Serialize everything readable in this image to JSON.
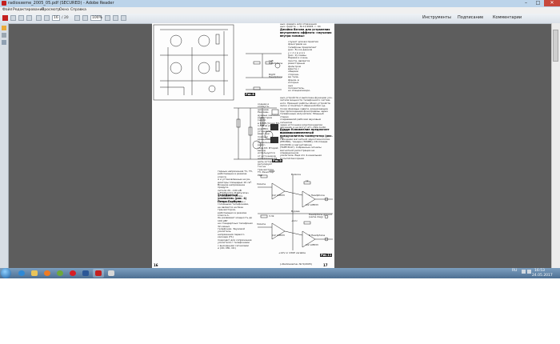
{
  "window": {
    "title": "radiosxeme_2005_05.pdf (SECURED) - Adobe Reader",
    "minimize_glyph": "–",
    "maximize_glyph": "□",
    "close_glyph": "✕"
  },
  "menu": {
    "items": [
      "Файл",
      "Редактирование",
      "Просмотр",
      "Окно",
      "Справка"
    ]
  },
  "toolbar": {
    "page_current": "16",
    "page_total": "/ 20",
    "zoom": "100%",
    "panel_tools": "Инструменты",
    "panel_sign": "Подписание",
    "panel_comments": "Комментарии"
  },
  "document": {
    "col_top_right": [
      "ных «радио» для отражения",
      "ных средств — Nr.11/2008, с. 40."
    ],
    "heading_1": "Джойки Вэгона для устранения внутреннего эффекта «звучания внутри головы»",
    "para_1": [
      "служит для восприятия фонограмм на",
      "телефоны предлагает",
      "(рис. 8) и в данном",
      "у с л о в и я х",
      "(рис. 9) схемы.",
      "Первая и очень",
      "проста, является",
      "резисторным",
      "фильтром",
      "вместе с",
      "общими",
      "сторона-",
      "ми теле-",
      "фонов, в",
      "которых",
      "ных",
      "положитель-",
      "но специализиро-"
    ],
    "para_2": [
      "ных устройств и выполнен функцию уси-",
      "лителя мощности телефонного систем-",
      "ного. Принцип работы обоих устройств",
      "легко и понятен Т-образной RLC це-",
      "почки фазовые сдвиги, возникающие",
      "при прохождении фонограммы через",
      "телефонные излучатели. Мощный стерео",
      "создаваемой рабочим звуковым сигналом",
      "через источники электроэнергии",
      "звучания, и не могут его «Wie Audio World»",
      "Nr.2/2001, с. 106)."
    ],
    "heading_2": "Ромам Кэмавеелин предлагает высококачественный предусилитель-коммутатор (рис. 7)",
    "para_3": [
      "с входами магнитной звукотехнологии",
      "(PHONO), тюнера (TUNER), CD-плеера (CD/DVD) и магнитофона",
      "(TAPE PLAY). Собранные сигналы",
      "магнитной регистрации на операционном",
      "усилителе. Ещё это 4-канальная мультиплексорная"
    ],
    "para_4": [
      "ходная и коммута-",
      "ционная. Рекомен-",
      "дуемые значения",
      "резисторов (число",
      "в 0,8 В (точно 5%",
      "1,5 В из резисто-",
      "ров PRC) устанавли-",
      "вают при помощи",
      "вращением",
      "переменного резис-",
      "тора R3. Второй",
      "выход используется",
      "от источников",
      "напряжения Т2,",
      "цепь которого",
      "регулирует",
      "ток на",
      "транзисторе",
      "T3. Резистор",
      "PR2"
    ],
    "para_5": [
      "тарные напряжения Т1, ТЗ,",
      "работающие в режиме класса",
      "А и установленные на ра-",
      "диаторы площадью 10 см².",
      "Входное напряжение предуси-",
      "лителя 20...100 мВ",
      "(«Elektronika Praktyczna»",
      "Nr.12/2005, с.49-51)."
    ],
    "heading_3": "Телефонный усилитель (рис. 4) Петра Горбули",
    "para_6": [
      "по звуковым блокам с головными телефонами,",
      "не является на базе транзисторов,",
      "работающих в режиме класса А.",
      "Он развивает мощность до 100 мВт",
      "на стандартных телефонах 32-омных",
      "телефонах. Звуковой усилитель",
      "напряжения первого каскада (Т1)",
      "подходит для сопряжения",
      "усилителя с телефонами",
      "с выходными сигналами",
      "и (CD, MD, ОС)"
    ],
    "fig_labels": [
      "Рис.8",
      "Рис.9",
      "Рис.11"
    ],
    "schematic_text": {
      "volume_top": "Volume",
      "volume_bottom": "Volume",
      "balance": "Balance",
      "bypass": "Bypass",
      "chip_1": "1/2 LM833",
      "chip_2": "1/2 LM833",
      "chip_3": "1/2 LM833",
      "chip_4": "1/2 LM833",
      "left_hp": "L Headphone",
      "gnd": "Headphone ground (same dwg)",
      "right_hp": "R Headphone",
      "r_label_1": "100k",
      "r_label_2": "1k",
      "r_label_3": "3.3k",
      "vcc": "+Vcc",
      "note": "+12V or 230P variable",
      "left_headphone": "Left Headphone",
      "right_headphone": "Right Headphone"
    },
    "page_numbers": [
      "16",
      "17"
    ],
    "footer_right": "(«Radiosxema» Nr.5/2005)"
  },
  "taskbar": {
    "time": "16:53",
    "date": "24.05.2017",
    "lang": "RU"
  },
  "colors": {
    "titlebar": "#bcd4ea",
    "close": "#c7483c",
    "desktop": "#5d5d5d",
    "taskbar": "#4d6f92"
  }
}
